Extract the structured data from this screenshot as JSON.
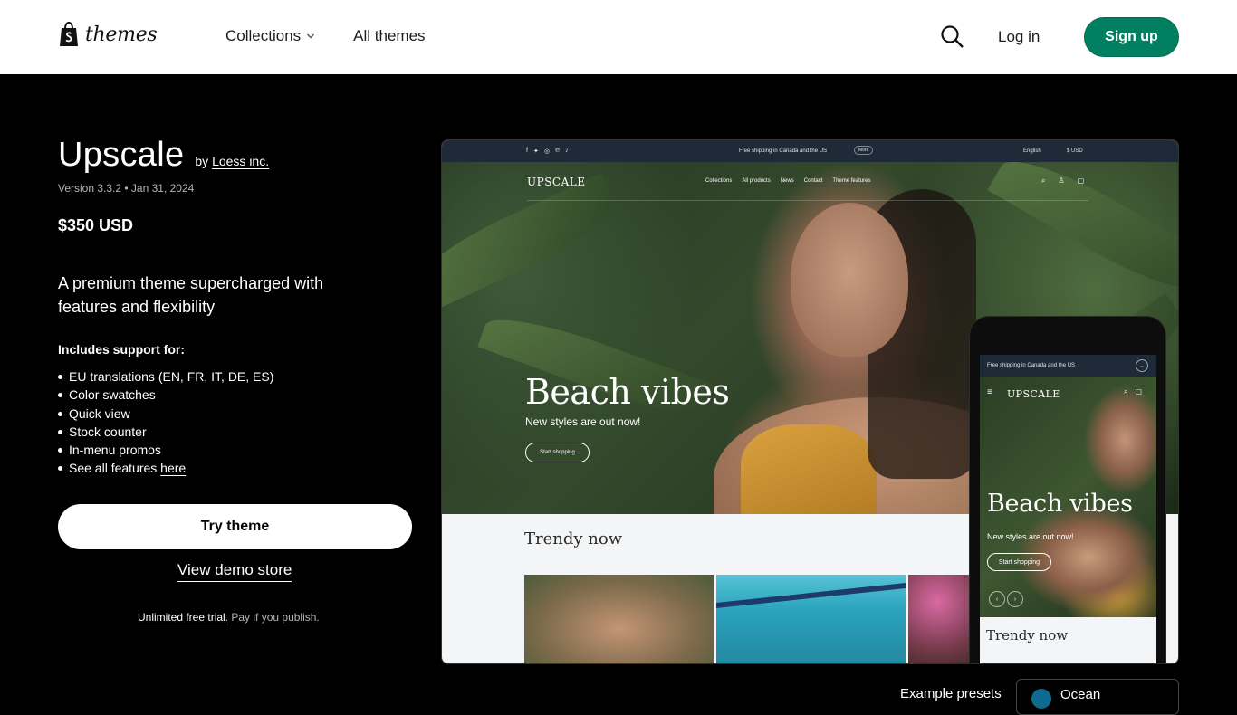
{
  "header": {
    "logo_text": "themes",
    "nav": {
      "collections": "Collections",
      "all_themes": "All themes"
    },
    "login": "Log in",
    "signup": "Sign up"
  },
  "theme": {
    "name": "Upscale",
    "by_prefix": "by",
    "author": "Loess inc.",
    "version": "Version 3.3.2 • Jan 31, 2024",
    "price": "$350 USD",
    "description": "A premium theme supercharged with features and flexibility",
    "support_heading": "Includes support for:",
    "features": [
      "EU translations (EN, FR, IT, DE, ES)",
      "Color swatches",
      "Quick view",
      "Stock counter",
      "In-menu promos"
    ],
    "features_more_prefix": "See all features ",
    "features_more_link": "here",
    "try_button": "Try theme",
    "demo_link": "View demo store",
    "trial_link": "Unlimited free trial",
    "trial_suffix": ". Pay if you publish."
  },
  "preview": {
    "social": [
      "f",
      "t",
      "ig",
      "p",
      "tt"
    ],
    "shipping": "Free shipping in Canada and the US",
    "more": "More",
    "language": "English",
    "currency": "$ USD",
    "brand": "UPSCALE",
    "nav_links": [
      "Collections",
      "All products",
      "News",
      "Contact",
      "Theme features"
    ],
    "hero_title": "Beach vibes",
    "hero_sub": "New styles are out now!",
    "hero_button": "Start shopping",
    "section_title": "Trendy now"
  },
  "phone": {
    "shipping": "Free shipping in Canada and the US",
    "brand": "UPSCALE",
    "hero_title": "Beach vibes",
    "hero_sub": "New styles are out now!",
    "hero_button": "Start shopping",
    "section_title": "Trendy now"
  },
  "footer_peek": {
    "label": "Example presets",
    "preset": "Ocean"
  },
  "colors": {
    "brand_green": "#008060",
    "topbar_dark": "#1e2a38"
  }
}
